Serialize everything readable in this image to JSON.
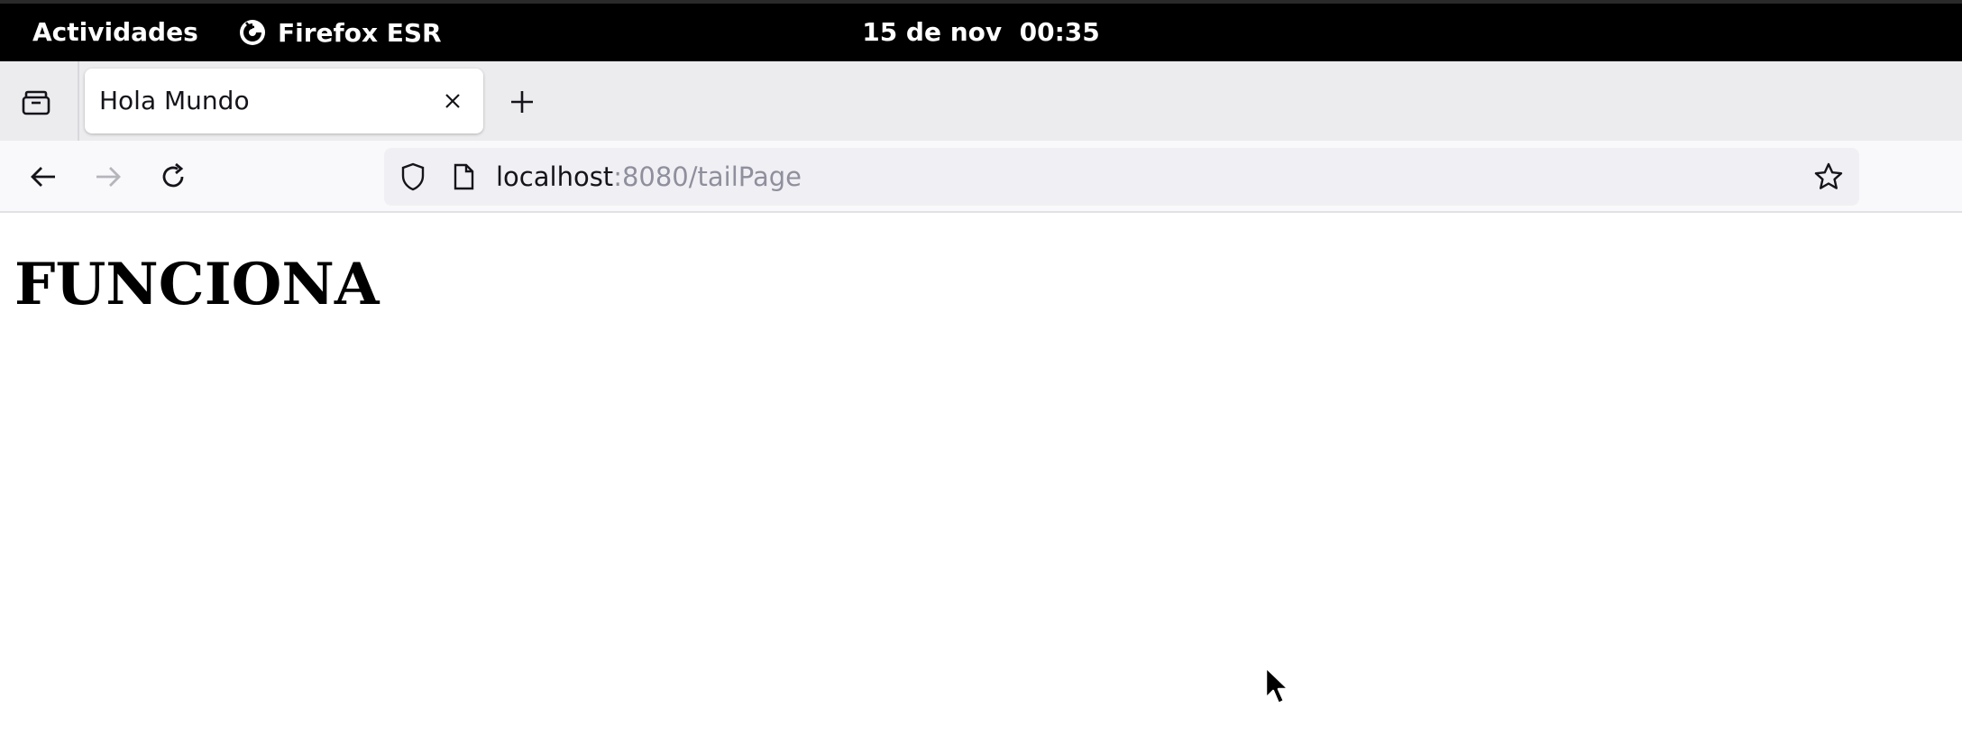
{
  "topbar": {
    "activities_label": "Actividades",
    "app_name": "Firefox ESR",
    "clock": "15 de nov  00:35",
    "app_icon": "firefox-icon"
  },
  "tabs": [
    {
      "title": "Hola Mundo",
      "active": true
    }
  ],
  "toolbar": {
    "back_icon": "arrow-left-icon",
    "forward_icon": "arrow-right-icon",
    "reload_icon": "reload-icon",
    "forward_enabled": false
  },
  "urlbar": {
    "host": "localhost",
    "rest": ":8080/tailPage",
    "bookmark_icon": "star-icon"
  },
  "page": {
    "heading": "FUNCIONA"
  },
  "colors": {
    "topbar_bg": "#000000",
    "tabstrip_bg": "#ececee",
    "navbar_bg": "#f9f9fb",
    "urlbar_bg": "#f0f0f4",
    "url_dim": "#8f8f9d"
  }
}
